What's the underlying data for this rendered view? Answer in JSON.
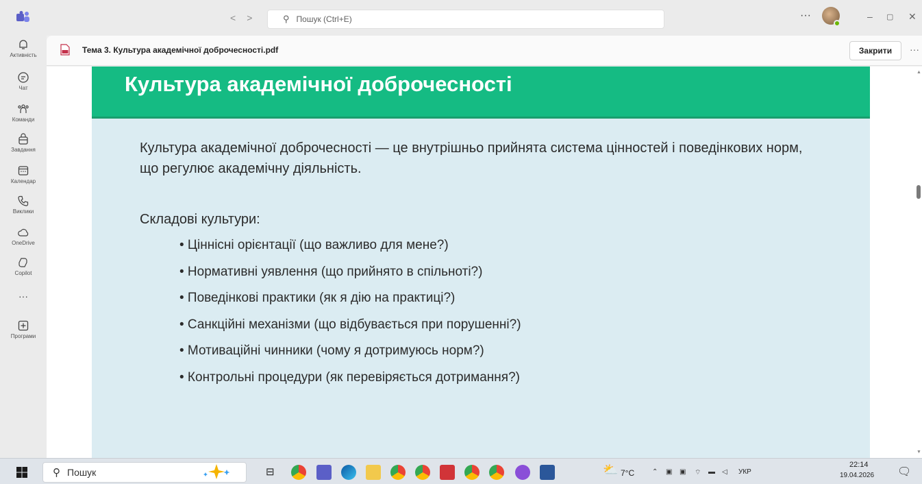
{
  "titlebar": {
    "search_placeholder": "Пошук (Ctrl+E)",
    "back_glyph": "<",
    "forward_glyph": ">",
    "more_glyph": "···",
    "min_glyph": "–",
    "restore_glyph": "▢",
    "close_glyph": "✕"
  },
  "rail": {
    "items": [
      {
        "label": "Активність",
        "icon": "bell-icon"
      },
      {
        "label": "Чат",
        "icon": "chat-icon"
      },
      {
        "label": "Команди",
        "icon": "teams-icon"
      },
      {
        "label": "Завдання",
        "icon": "tasks-icon"
      },
      {
        "label": "Календар",
        "icon": "calendar-icon"
      },
      {
        "label": "Виклики",
        "icon": "phone-icon"
      },
      {
        "label": "OneDrive",
        "icon": "cloud-icon"
      },
      {
        "label": "Copilot",
        "icon": "copilot-icon"
      },
      {
        "label": "···",
        "icon": "more-icon"
      },
      {
        "label": "Програми",
        "icon": "add-apps-icon"
      }
    ]
  },
  "file": {
    "title": "Тема 3. Культура академічної доброчесності.pdf",
    "close_label": "Закрити",
    "more_glyph": "···"
  },
  "slide": {
    "title": "Культура академічної доброчесності",
    "definition": "Культура академічної доброчесності — це внутрішньо прийнята система цінностей і поведінкових норм, що регулює академічну діяльність.",
    "subheading": "Складові культури:",
    "items": [
      "• Ціннісні орієнтації (що важливо для мене?)",
      "• Нормативні уявлення (що прийнято в спільноті?)",
      "• Поведінкові практики (як я дію на практиці?)",
      "• Санкційні механізми (що відбувається при порушенні?)",
      "• Мотиваційні чинники (чому я дотримуюсь норм?)",
      "• Контрольні процедури (як перевіряється дотримання?)"
    ]
  },
  "taskbar": {
    "search_label": "Пошук",
    "weather": "7°C",
    "language": "УКР",
    "time": "22:14",
    "date": "19.04.2026"
  },
  "colors": {
    "slide_header": "#15bb83",
    "slide_body": "#dbecf2",
    "teams_purple": "#5b5fc7"
  }
}
